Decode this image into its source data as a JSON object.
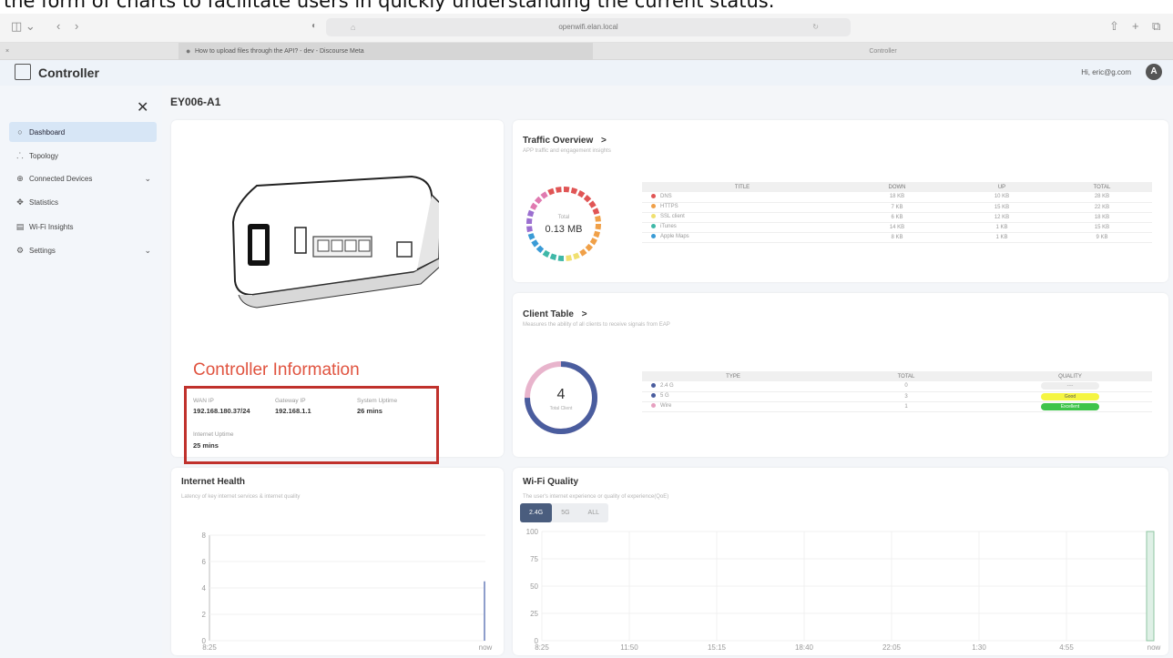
{
  "caption": "the form of charts to facilitate users in quickly understanding the current status.",
  "browser": {
    "address": "openwifi.elan.local",
    "tabs": [
      {
        "label": "How to upload files through the API? - dev - Discourse Meta"
      },
      {
        "label": "Controller"
      }
    ]
  },
  "app": {
    "title": "Controller",
    "user_email": "Hi, eric@g.com",
    "avatar_letter": "A"
  },
  "sidebar": {
    "items": [
      {
        "label": "Dashboard",
        "icon": "dashboard-icon",
        "active": true
      },
      {
        "label": "Topology",
        "icon": "topology-icon"
      },
      {
        "label": "Connected Devices",
        "icon": "devices-icon",
        "expandable": true
      },
      {
        "label": "Statistics",
        "icon": "statistics-icon"
      },
      {
        "label": "Wi-Fi Insights",
        "icon": "insights-icon"
      },
      {
        "label": "Settings",
        "icon": "gear-icon",
        "expandable": true
      }
    ]
  },
  "page": {
    "title": "EY006-A1"
  },
  "controller_info": {
    "title": "Controller Information",
    "wan_ip_label": "WAN IP",
    "wan_ip": "192.168.180.37/24",
    "gateway_ip_label": "Gateway IP",
    "gateway_ip": "192.168.1.1",
    "system_uptime_label": "System Uptime",
    "system_uptime": "26 mins",
    "internet_uptime_label": "Internet Uptime",
    "internet_uptime": "25 mins"
  },
  "traffic": {
    "title": "Traffic Overview",
    "subtitle": "APP traffic and engagement insights",
    "donut_label": "Total",
    "donut_value": "0.13 MB",
    "columns": [
      "TITLE",
      "DOWN",
      "UP",
      "TOTAL"
    ],
    "rows": [
      {
        "name": "DNS",
        "down": "18 KB",
        "up": "10 KB",
        "total": "28 KB",
        "color": "#e05555"
      },
      {
        "name": "HTTPS",
        "down": "7 KB",
        "up": "15 KB",
        "total": "22 KB",
        "color": "#f0a048"
      },
      {
        "name": "SSL client",
        "down": "6 KB",
        "up": "12 KB",
        "total": "18 KB",
        "color": "#f0e070"
      },
      {
        "name": "iTunes",
        "down": "14 KB",
        "up": "1 KB",
        "total": "15 KB",
        "color": "#3fb8a8"
      },
      {
        "name": "Apple Maps",
        "down": "8 KB",
        "up": "1 KB",
        "total": "9 KB",
        "color": "#3a9bd6"
      }
    ]
  },
  "clients": {
    "title": "Client Table",
    "subtitle": "Measures the ability of all clients to receive signals from EAP",
    "total": "4",
    "total_label": "Total Client",
    "columns": [
      "TYPE",
      "TOTAL",
      "QUALITY"
    ],
    "rows": [
      {
        "type": "2.4 G",
        "total": "0",
        "quality": "----",
        "color": "#4a5d9e",
        "qcolor": "#eeeeee"
      },
      {
        "type": "5 G",
        "total": "3",
        "quality": "Good",
        "color": "#4a5d9e",
        "qcolor": "#f5f542"
      },
      {
        "type": "Wire",
        "total": "1",
        "quality": "Excellent",
        "color": "#e6a0c0",
        "qcolor": "#3ec44a"
      }
    ]
  },
  "health": {
    "title": "Internet Health",
    "subtitle": "Latency of key internet services & internet quality"
  },
  "wifi": {
    "title": "Wi-Fi Quality",
    "subtitle": "The user's internet experience or quality of experience(QoE)",
    "toggle": [
      "2.4G",
      "5G",
      "ALL"
    ],
    "toggle_selected": "2.4G"
  },
  "colors": {
    "accent_red": "#e0533f",
    "highlight_box": "#c0312c",
    "sidebar_active": "#d7e6f6"
  },
  "chart_data": [
    {
      "type": "line",
      "title": "Internet Health",
      "x": [
        "8:25",
        "now"
      ],
      "ylim": [
        0,
        8
      ],
      "yticks": [
        0,
        2,
        4,
        6,
        8
      ],
      "series": [
        {
          "values": [
            0,
            0,
            0,
            0,
            0,
            0,
            0,
            4.5
          ]
        }
      ]
    },
    {
      "type": "area",
      "title": "Wi-Fi Quality",
      "x": [
        "8:25",
        "11:50",
        "15:15",
        "18:40",
        "22:05",
        "1:30",
        "4:55",
        "now"
      ],
      "ylim": [
        0,
        100
      ],
      "yticks": [
        0,
        25,
        50,
        75,
        100
      ],
      "series": [
        {
          "values": [
            0,
            0,
            0,
            0,
            0,
            0,
            0,
            100
          ]
        }
      ]
    }
  ]
}
